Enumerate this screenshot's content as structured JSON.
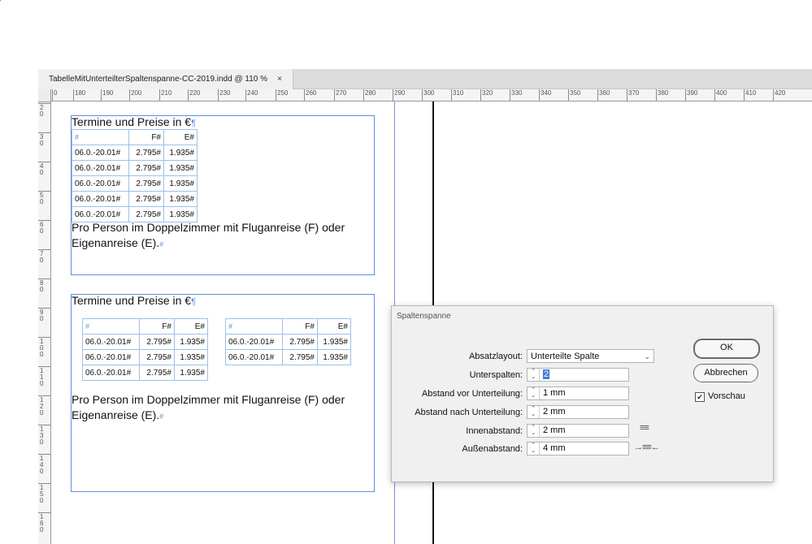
{
  "document_tab": {
    "title": "TabelleMitUnterteilterSpaltenspanne-CC-2019.indd @ 110 %",
    "close": "×"
  },
  "rulers": {
    "horizontal": [
      "0",
      "180",
      "190",
      "200",
      "210",
      "220",
      "230",
      "240",
      "250",
      "260",
      "270",
      "280",
      "290",
      "300",
      "310",
      "320",
      "330",
      "340",
      "350",
      "360",
      "370",
      "380",
      "390",
      "400",
      "410",
      "420"
    ],
    "vertical": [
      "20",
      "30",
      "40",
      "50",
      "60",
      "70",
      "80",
      "90",
      "100",
      "110",
      "120",
      "130",
      "140",
      "150",
      "160"
    ]
  },
  "frame1": {
    "heading": "Termine und Preise in €",
    "pilcrow": "¶",
    "table": {
      "header": [
        "#",
        "F#",
        "E#"
      ],
      "rows": [
        [
          "06.0.-20.01#",
          "2.795#",
          "1.935#"
        ],
        [
          "06.0.-20.01#",
          "2.795#",
          "1.935#"
        ],
        [
          "06.0.-20.01#",
          "2.795#",
          "1.935#"
        ],
        [
          "06.0.-20.01#",
          "2.795#",
          "1.935#"
        ],
        [
          "06.0.-20.01#",
          "2.795#",
          "1.935#"
        ]
      ]
    },
    "text_line1": "Pro Person im Doppelzimmer mit Fluganreise (F) oder",
    "text_line2": "Eigenanreise (E).",
    "end_mark": "#"
  },
  "frame2": {
    "heading": "Termine und Preise in €",
    "pilcrow": "¶",
    "table_left": {
      "header": [
        "#",
        "F#",
        "E#"
      ],
      "rows": [
        [
          "06.0.-20.01#",
          "2.795#",
          "1.935#"
        ],
        [
          "06.0.-20.01#",
          "2.795#",
          "1.935#"
        ],
        [
          "06.0.-20.01#",
          "2.795#",
          "1.935#"
        ]
      ]
    },
    "table_right": {
      "header": [
        "#",
        "F#",
        "E#"
      ],
      "rows": [
        [
          "06.0.-20.01#",
          "2.795#",
          "1.935#"
        ],
        [
          "06.0.-20.01#",
          "2.795#",
          "1.935#"
        ]
      ]
    },
    "text_line1": "Pro Person im Doppelzimmer mit Fluganreise (F) oder",
    "text_line2": "Eigenanreise (E).",
    "end_mark": "#"
  },
  "dialog": {
    "title": "Spaltenspanne",
    "absatzlayout_label": "Absatzlayout:",
    "absatzlayout_value": "Unterteilte Spalte",
    "unterspalten_label": "Unterspalten:",
    "unterspalten_value": "2",
    "abstand_vor_label": "Abstand vor Unterteilung:",
    "abstand_vor_value": "1 mm",
    "abstand_nach_label": "Abstand nach Unterteilung:",
    "abstand_nach_value": "2 mm",
    "innenabstand_label": "Innenabstand:",
    "innenabstand_value": "2 mm",
    "aussenabstand_label": "Außenabstand:",
    "aussenabstand_value": "4 mm",
    "ok_label": "OK",
    "cancel_label": "Abbrechen",
    "preview_label": "Vorschau",
    "preview_checked": true
  },
  "colors": {
    "frame_border": "#5b8fe0",
    "margin_guide": "#a67ad9",
    "selection": "#3b7dd8"
  }
}
